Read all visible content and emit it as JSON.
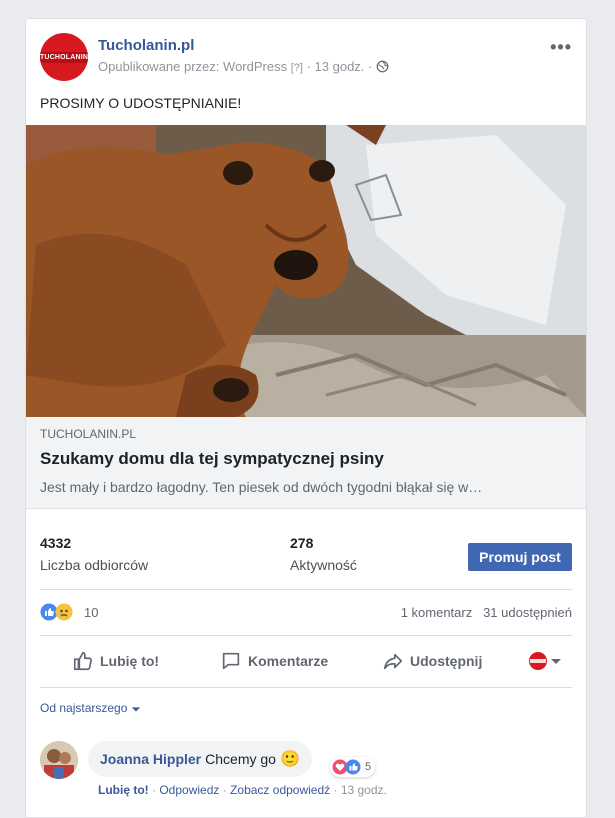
{
  "post": {
    "page_name": "Tucholanin.pl",
    "avatar_text": "TUCHOLANIN",
    "published_by_prefix": "Opublikowane przez:",
    "published_by": "WordPress",
    "help_mark": "[?]",
    "time": "13 godz.",
    "separator": "·",
    "more_icon": "more-icon",
    "text": "PROSIMY O UDOSTĘPNIANIE!"
  },
  "link": {
    "domain": "TUCHOLANIN.PL",
    "title": "Szukamy domu dla tej sympatycznej psiny",
    "description": "Jest mały i bardzo łagodny. Ten piesek od dwóch tygodni błąkał się w…"
  },
  "stats": {
    "reach_value": "4332",
    "reach_label": "Liczba odbiorców",
    "engagement_value": "278",
    "engagement_label": "Aktywność",
    "promote_label": "Promuj post"
  },
  "reactions": {
    "count": "10",
    "comments": "1 komentarz",
    "shares": "31 udostępnień"
  },
  "actions": {
    "like": "Lubię to!",
    "comment": "Komentarze",
    "share": "Udostępnij"
  },
  "sort": {
    "label": "Od najstarszego"
  },
  "comment": {
    "author": "Joanna Hippler",
    "text": "Chcemy go",
    "emoji": "🙂",
    "reaction_count": "5",
    "like": "Lubię to!",
    "reply": "Odpowiedz",
    "see_replies": "Zobacz odpowiedź",
    "time": "13 godz."
  },
  "colors": {
    "link_blue": "#365899",
    "promote_bg": "#4267b2",
    "brand_red": "#d71920"
  }
}
